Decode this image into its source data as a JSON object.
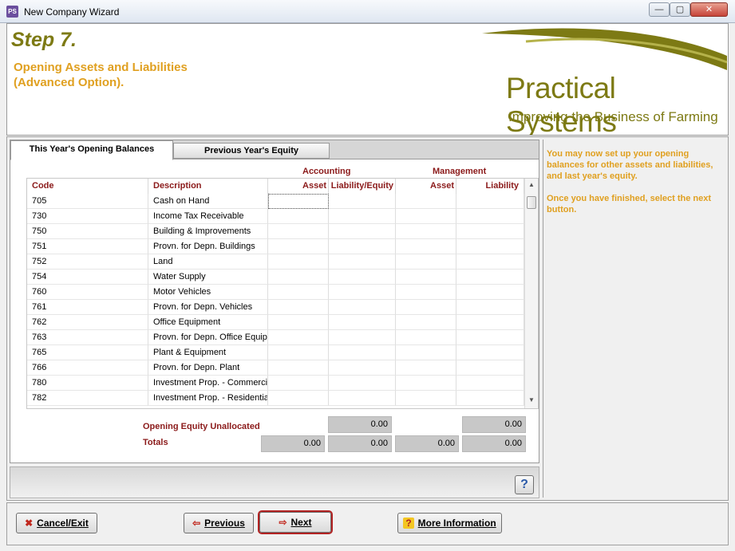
{
  "window": {
    "title": "New Company Wizard",
    "icon": "PS",
    "min": "—",
    "max": "▢",
    "close": "✕"
  },
  "header": {
    "step": "Step 7.",
    "subtitle_line1": "Opening Assets and Liabilities",
    "subtitle_line2": "(Advanced Option).",
    "logo_title": "Practical Systems",
    "logo_subtitle": "Improving the Business of Farming",
    "brand_color": "#7d7a14",
    "accent_color": "#e0a020"
  },
  "tabs": {
    "this_year": "This Year's Opening Balances",
    "previous_year": "Previous Year's Equity"
  },
  "sections": {
    "accounting": "Accounting",
    "management": "Management"
  },
  "grid": {
    "headers": {
      "code": "Code",
      "description": "Description",
      "acc_asset": "Asset",
      "acc_liability": "Liability/Equity",
      "mgmt_asset": "Asset",
      "mgmt_liability": "Liability"
    },
    "rows": [
      {
        "code": "705",
        "description": "Cash on Hand"
      },
      {
        "code": "730",
        "description": "Income Tax Receivable"
      },
      {
        "code": "750",
        "description": "Building & Improvements"
      },
      {
        "code": "751",
        "description": "Provn. for Depn. Buildings"
      },
      {
        "code": "752",
        "description": "Land"
      },
      {
        "code": "754",
        "description": "Water Supply"
      },
      {
        "code": "760",
        "description": "Motor Vehicles"
      },
      {
        "code": "761",
        "description": "Provn. for Depn. Vehicles"
      },
      {
        "code": "762",
        "description": "Office Equipment"
      },
      {
        "code": "763",
        "description": "Provn. for Depn. Office Equip."
      },
      {
        "code": "765",
        "description": "Plant & Equipment"
      },
      {
        "code": "766",
        "description": "Provn. for Depn. Plant"
      },
      {
        "code": "780",
        "description": "Investment Prop. - Commercial"
      },
      {
        "code": "782",
        "description": "Investment Prop. - Residential"
      }
    ]
  },
  "footer": {
    "equity_label": "Opening Equity Unallocated",
    "equity_acc_liability": "0.00",
    "equity_mgmt_liability": "0.00",
    "totals_label": "Totals",
    "tot_acc_asset": "0.00",
    "tot_acc_liability": "0.00",
    "tot_mgmt_asset": "0.00",
    "tot_mgmt_liability": "0.00"
  },
  "help": {
    "label": "?"
  },
  "side": {
    "text1": "You may now set up your opening balances for other assets and liabilities, and last year's equity.",
    "text2": "Once you have finished, select the next button."
  },
  "buttons": {
    "cancel_icon": "✖",
    "cancel": "Cancel/Exit",
    "previous_icon": "⇦",
    "previous": "Previous",
    "next_icon": "⇨",
    "next": "Next",
    "info_icon": "?",
    "info": "More Information"
  }
}
